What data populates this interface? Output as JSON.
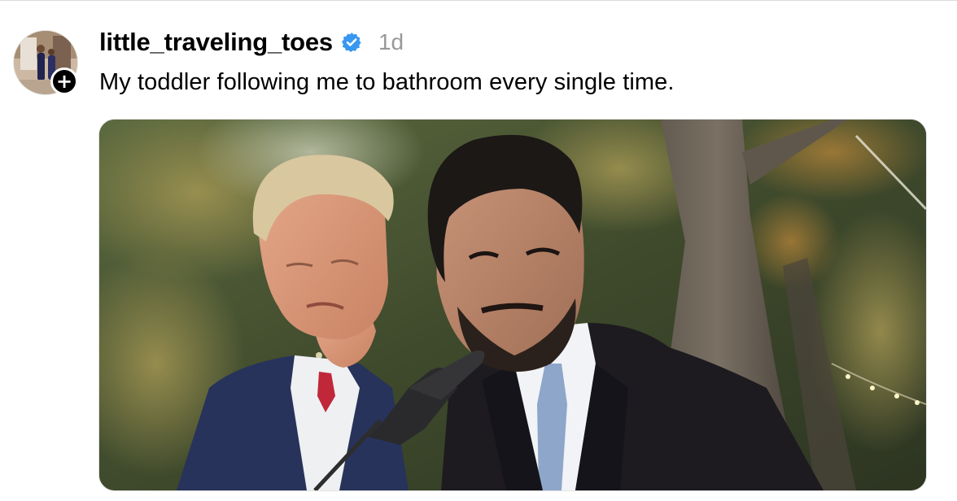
{
  "post": {
    "username": "little_traveling_toes",
    "verified": true,
    "timestamp": "1d",
    "caption": "My toddler following me to bathroom every single time.",
    "follow_badge": "+"
  },
  "icons": {
    "avatar": "avatar",
    "follow": "plus-icon",
    "verified": "verified-badge-icon"
  },
  "colors": {
    "verified_badge": "#3897f0",
    "timestamp": "#999999",
    "text": "#000000"
  }
}
